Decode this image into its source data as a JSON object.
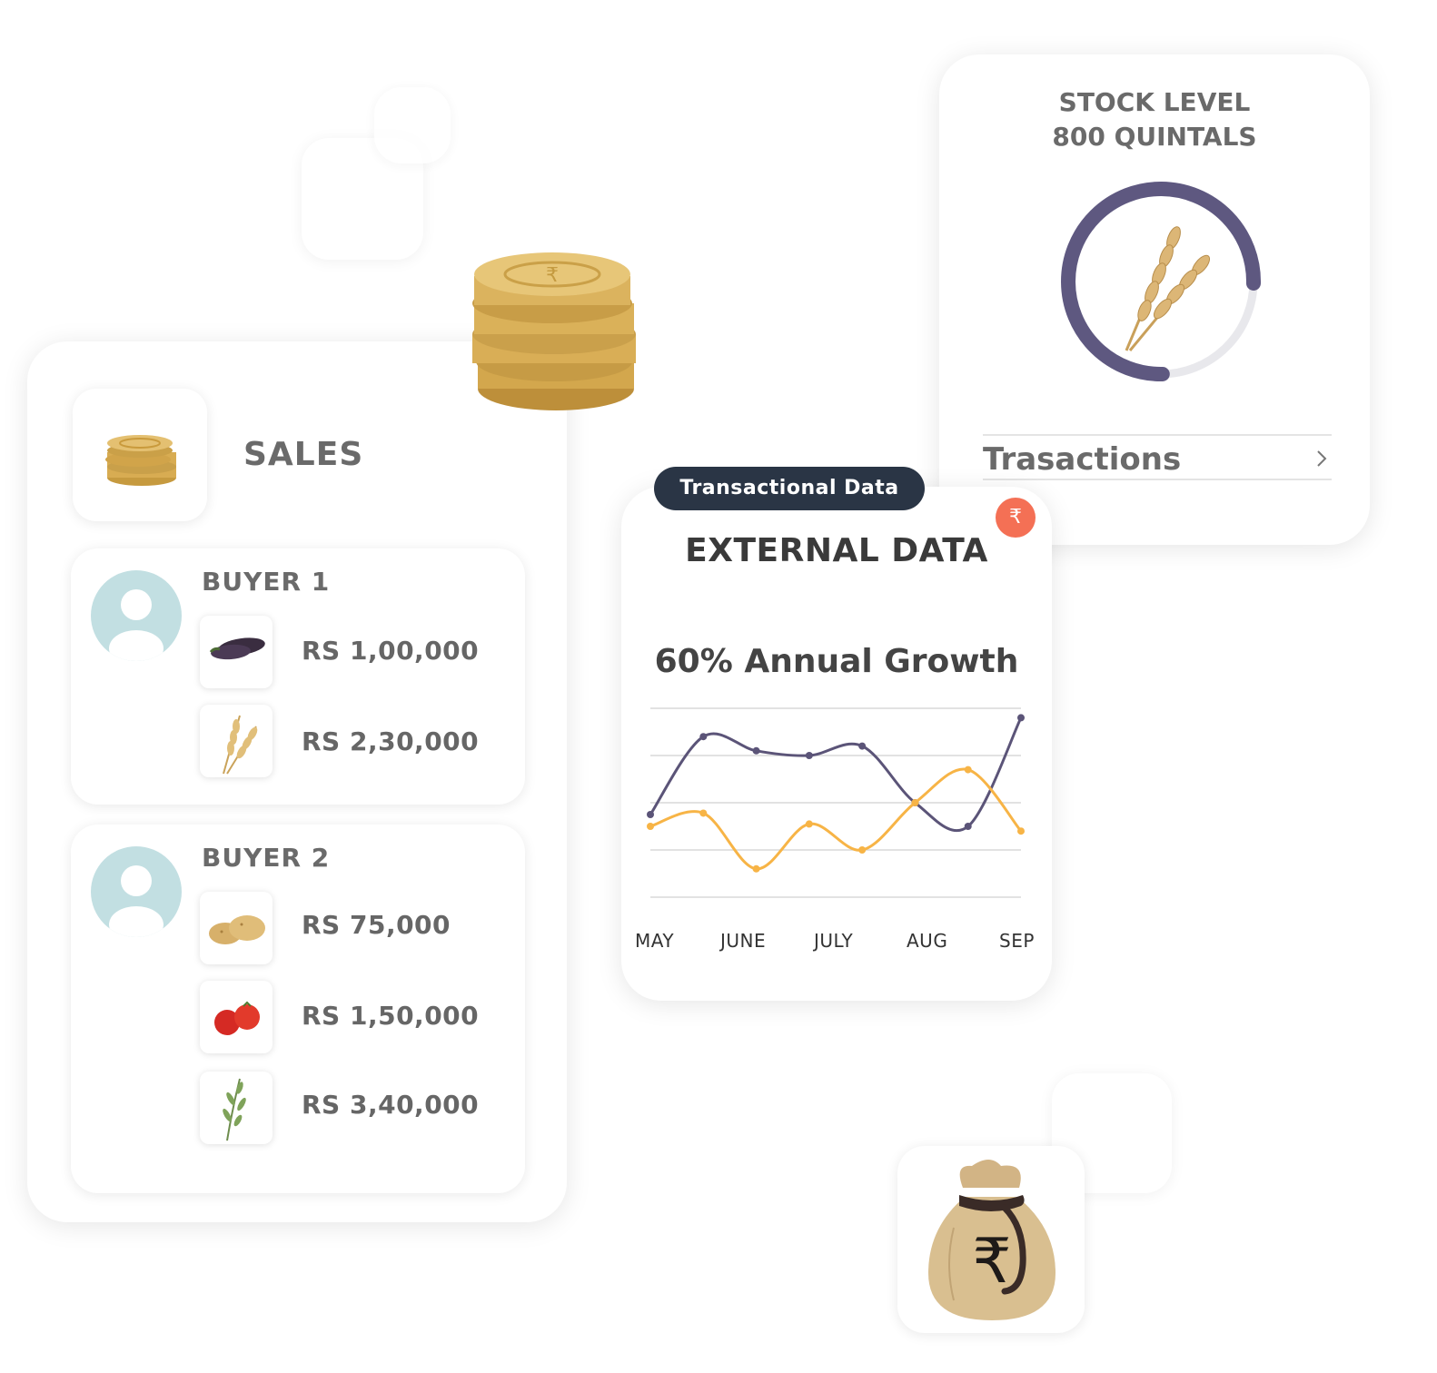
{
  "sales": {
    "title": "SALES",
    "buyers": [
      {
        "name": "BUYER 1",
        "items": [
          {
            "icon": "eggplant-icon",
            "amount": "RS 1,00,000"
          },
          {
            "icon": "wheat-icon",
            "amount": "RS 2,30,000"
          }
        ]
      },
      {
        "name": "BUYER 2",
        "items": [
          {
            "icon": "potato-icon",
            "amount": "RS 75,000"
          },
          {
            "icon": "tomato-icon",
            "amount": "RS 1,50,000"
          },
          {
            "icon": "herb-icon",
            "amount": "RS 3,40,000"
          }
        ]
      }
    ]
  },
  "stock": {
    "title_line1": "STOCK LEVEL",
    "title_line2": "800 QUINTALS",
    "transactions_label": "Trasactions"
  },
  "external": {
    "pill_label": "Transactional Data",
    "badge_symbol": "₹",
    "title": "EXTERNAL DATA",
    "growth_label": "60% Annual Growth"
  },
  "colors": {
    "series_purple": "#5b5478",
    "series_orange": "#f7b446",
    "avatar": "#c2dfe2",
    "badge": "#f47055",
    "pill": "#2a3545",
    "gauge_track": "#e8e8ec"
  },
  "chart_data": {
    "type": "line",
    "categories": [
      "MAY",
      "JUNE",
      "JULY",
      "AUG",
      "SEP"
    ],
    "grid": true,
    "legend": "none",
    "series": [
      {
        "values": [
          1.75,
          3.4,
          3.1,
          3.0,
          3.2,
          2.0,
          1.5,
          3.8
        ]
      },
      {
        "values": [
          1.5,
          1.78,
          0.6,
          1.55,
          1.0,
          2.0,
          2.7,
          1.4
        ]
      }
    ]
  }
}
